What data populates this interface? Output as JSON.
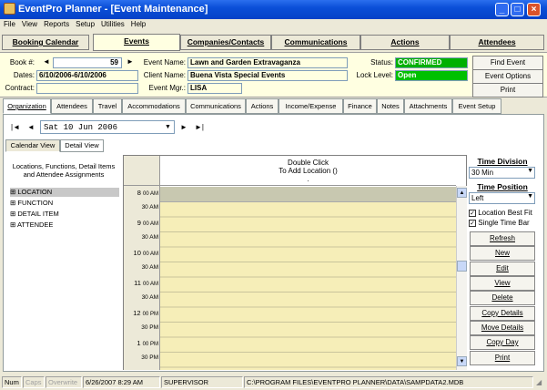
{
  "window": {
    "title": "EventPro Planner - [Event Maintenance]"
  },
  "menu": [
    "File",
    "View",
    "Reports",
    "Setup",
    "Utilities",
    "Help"
  ],
  "main_tabs": [
    "Booking Calendar",
    "Events",
    "Companies/Contacts",
    "Communications",
    "Actions",
    "Attendees"
  ],
  "form": {
    "book_label": "Book #:",
    "book_value": "59",
    "dates_label": "Dates:",
    "dates_value": "6/10/2006-6/10/2006",
    "contract_label": "Contract:",
    "contract_value": "",
    "event_name_label": "Event Name:",
    "event_name_value": "Lawn and Garden Extravaganza",
    "client_name_label": "Client Name:",
    "client_name_value": "Buena Vista Special Events",
    "event_mgr_label": "Event Mgr.:",
    "event_mgr_value": "LISA",
    "status_label": "Status:",
    "status_value": "CONFIRMED",
    "lock_label": "Lock Level:",
    "lock_value": "Open"
  },
  "side_buttons": [
    "Find Event",
    "Event Options",
    "Print"
  ],
  "sub_tabs": [
    "Organization",
    "Attendees",
    "Travel",
    "Accommodations",
    "Communications",
    "Actions",
    "Income/Expense",
    "Finance",
    "Notes",
    "Attachments",
    "Event Setup"
  ],
  "date_nav": {
    "date": "Sat  10 Jun 2006"
  },
  "view_tabs": [
    "Calendar View",
    "Detail View"
  ],
  "tree": {
    "header": "Locations, Functions, Detail Items and Attendee Assignments",
    "items": [
      "LOCATION",
      "FUNCTION",
      "DETAIL ITEM",
      "ATTENDEE"
    ]
  },
  "grid": {
    "col_line1": "Double Click",
    "col_line2": "To Add Location ()",
    "col_line3": ".",
    "times": [
      "8",
      "00 AM",
      "30 AM",
      "9",
      "00 AM",
      "30 AM",
      "10",
      "00 AM",
      "30 AM",
      "11",
      "00 AM",
      "30 AM",
      "12",
      "00 PM",
      "30 PM",
      "1",
      "00 PM",
      "30 PM"
    ]
  },
  "right": {
    "time_division_label": "Time Division",
    "time_division_value": "30 Min",
    "time_position_label": "Time Position",
    "time_position_value": "Left",
    "location_best_fit": "Location Best Fit",
    "single_time_bar": "Single Time Bar",
    "buttons": [
      "Refresh",
      "New",
      "Edit",
      "View",
      "Delete",
      "Copy Details",
      "Move Details",
      "Copy Day",
      "Print"
    ]
  },
  "status": {
    "num": "Num",
    "caps": "Caps",
    "overwrite": "Overwrite",
    "datetime": "6/26/2007 8:29 AM",
    "user": "SUPERVISOR",
    "path": "C:\\PROGRAM FILES\\EVENTPRO PLANNER\\DATA\\SAMPDATA2.MDB"
  },
  "colors": {
    "title_blue": "#0A4FD8",
    "status_green": "#00B000",
    "field_yellow": "#FFFFE1",
    "grid_yellow": "#F6EEB8",
    "grid_gray": "#C8C8B0"
  }
}
